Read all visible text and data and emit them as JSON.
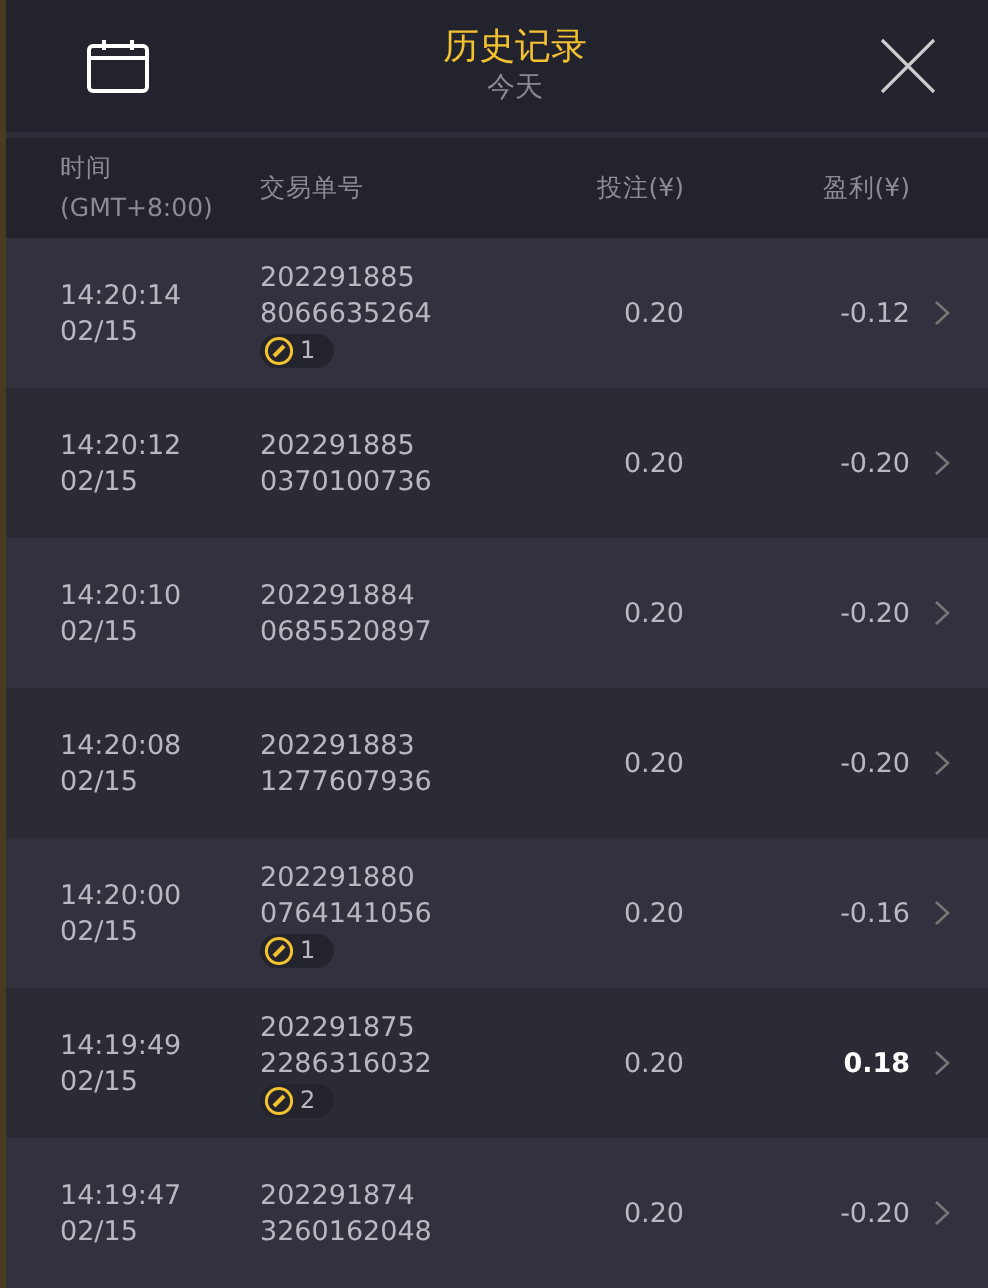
{
  "header": {
    "title": "历史记录",
    "subtitle": "今天"
  },
  "columns": {
    "time": [
      "时间",
      "(GMT+8:00)"
    ],
    "order": "交易单号",
    "bet": "投注(¥)",
    "profit": "盈利(¥)"
  },
  "rows": [
    {
      "time": "14:20:14",
      "date": "02/15",
      "order": [
        "202291885",
        "8066635264"
      ],
      "badge": "1",
      "bet": "0.20",
      "profit": "-0.12",
      "win": false
    },
    {
      "time": "14:20:12",
      "date": "02/15",
      "order": [
        "202291885",
        "0370100736"
      ],
      "bet": "0.20",
      "profit": "-0.20",
      "win": false
    },
    {
      "time": "14:20:10",
      "date": "02/15",
      "order": [
        "202291884",
        "0685520897"
      ],
      "bet": "0.20",
      "profit": "-0.20",
      "win": false
    },
    {
      "time": "14:20:08",
      "date": "02/15",
      "order": [
        "202291883",
        "1277607936"
      ],
      "bet": "0.20",
      "profit": "-0.20",
      "win": false
    },
    {
      "time": "14:20:00",
      "date": "02/15",
      "order": [
        "202291880",
        "0764141056"
      ],
      "badge": "1",
      "bet": "0.20",
      "profit": "-0.16",
      "win": false
    },
    {
      "time": "14:19:49",
      "date": "02/15",
      "order": [
        "202291875",
        "2286316032"
      ],
      "badge": "2",
      "bet": "0.20",
      "profit": "0.18",
      "win": true
    },
    {
      "time": "14:19:47",
      "date": "02/15",
      "order": [
        "202291874",
        "3260162048"
      ],
      "bet": "0.20",
      "profit": "-0.20",
      "win": false
    }
  ]
}
